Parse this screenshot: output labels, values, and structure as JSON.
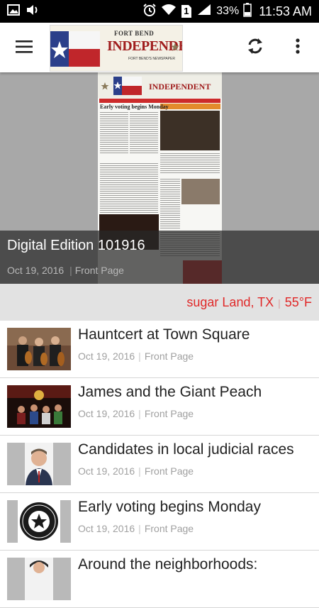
{
  "status_bar": {
    "battery_pct": "33%",
    "time": "11:53 AM",
    "sim_label": "1"
  },
  "app_bar": {
    "logo_top": "FORT BEND",
    "logo_main": "INDEPENDENT",
    "logo_tagline": "FORT BEND'S NEWSPAPER"
  },
  "featured": {
    "title": "Digital Edition 101916",
    "date": "Oct 19, 2016",
    "category": "Front Page",
    "paper_headline": "Early voting begins Monday"
  },
  "weather": {
    "location": "sugar Land, TX",
    "separator": "|",
    "temperature": "55°F"
  },
  "articles": [
    {
      "title": "Hauntcert at Town Square",
      "date": "Oct 19, 2016",
      "category": "Front Page",
      "thumb": "musicians-photo"
    },
    {
      "title": "James and the Giant Peach",
      "date": "Oct 19, 2016",
      "category": "Front Page",
      "thumb": "stage-play-photo"
    },
    {
      "title": "Candidates in local judicial races",
      "date": "Oct 19, 2016",
      "category": "Front Page",
      "thumb": "candidate-photo"
    },
    {
      "title": "Early voting begins Monday",
      "date": "Oct 19, 2016",
      "category": "Front Page",
      "thumb": "county-seal"
    },
    {
      "title": "Around the neighborhoods:",
      "date": "",
      "category": "",
      "thumb": "portrait-photo"
    }
  ],
  "colors": {
    "accent_red": "#e02828",
    "status_bar": "#000000",
    "meta_gray": "#a0a0a0"
  }
}
